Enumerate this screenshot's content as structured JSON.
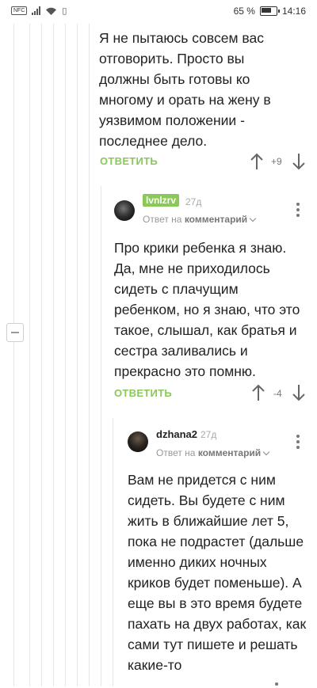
{
  "status_bar": {
    "nfc_label": "NFC",
    "battery_percent": "65 %",
    "time": "14:16",
    "battery_level": 0.65
  },
  "comments": [
    {
      "text": "Я не пытаюсь совсем вас отговорить. Просто вы должны быть готовы ко многому и орать на жену в уязвимом положении - последнее дело.",
      "reply_label": "ОТВЕТИТЬ",
      "rating": "+9"
    },
    {
      "username": "lvnlzrv",
      "time": "27д",
      "reply_to_prefix": "Ответ на",
      "reply_to_target": "комментарий",
      "text": "Про крики ребенка я знаю. Да, мне не приходилось сидеть с плачущим ребенком, но я знаю, что это такое, слышал, как братья и сестра заливались и прекрасно это помню.",
      "reply_label": "ОТВЕТИТЬ",
      "rating": "-4"
    },
    {
      "username": "dzhana2",
      "time": "27д",
      "reply_to_prefix": "Ответ на",
      "reply_to_target": "комментарий",
      "text": "Вам не придется с ним сидеть. Вы будете с ним жить в ближайшие лет 5, пока не подрастет (дальше именно диких ночных криков будет поменьше). А еще вы в это время будете пахать на двух работах, как сами тут пишете и решать какие-то"
    }
  ]
}
